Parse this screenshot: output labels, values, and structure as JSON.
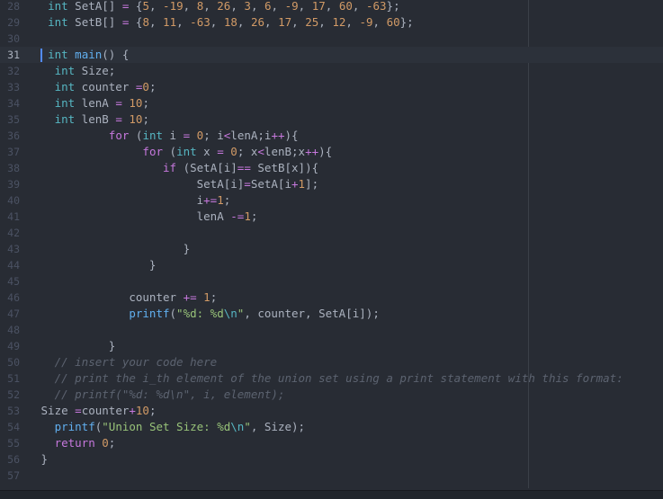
{
  "editor": {
    "active_line": 31,
    "wrap_guide_column": 80,
    "colors": {
      "background": "#282c34",
      "keyword": "#c678dd",
      "type": "#56b6c2",
      "function": "#61afef",
      "number": "#d19a66",
      "string": "#98c379",
      "comment": "#5c6370",
      "plain": "#abb2bf",
      "cursor": "#528bff"
    },
    "lines": [
      {
        "n": "28",
        "tokens": [
          [
            "pl",
            "  "
          ],
          [
            "ty",
            "int"
          ],
          [
            "pl",
            " SetA[] "
          ],
          [
            "op",
            "="
          ],
          [
            "pl",
            " {"
          ],
          [
            "num",
            "5"
          ],
          [
            "pl",
            ", "
          ],
          [
            "num",
            "-19"
          ],
          [
            "pl",
            ", "
          ],
          [
            "num",
            "8"
          ],
          [
            "pl",
            ", "
          ],
          [
            "num",
            "26"
          ],
          [
            "pl",
            ", "
          ],
          [
            "num",
            "3"
          ],
          [
            "pl",
            ", "
          ],
          [
            "num",
            "6"
          ],
          [
            "pl",
            ", "
          ],
          [
            "num",
            "-9"
          ],
          [
            "pl",
            ", "
          ],
          [
            "num",
            "17"
          ],
          [
            "pl",
            ", "
          ],
          [
            "num",
            "60"
          ],
          [
            "pl",
            ", "
          ],
          [
            "num",
            "-63"
          ],
          [
            "pl",
            "};"
          ]
        ]
      },
      {
        "n": "29",
        "tokens": [
          [
            "pl",
            "  "
          ],
          [
            "ty",
            "int"
          ],
          [
            "pl",
            " SetB[] "
          ],
          [
            "op",
            "="
          ],
          [
            "pl",
            " {"
          ],
          [
            "num",
            "8"
          ],
          [
            "pl",
            ", "
          ],
          [
            "num",
            "11"
          ],
          [
            "pl",
            ", "
          ],
          [
            "num",
            "-63"
          ],
          [
            "pl",
            ", "
          ],
          [
            "num",
            "18"
          ],
          [
            "pl",
            ", "
          ],
          [
            "num",
            "26"
          ],
          [
            "pl",
            ", "
          ],
          [
            "num",
            "17"
          ],
          [
            "pl",
            ", "
          ],
          [
            "num",
            "25"
          ],
          [
            "pl",
            ", "
          ],
          [
            "num",
            "12"
          ],
          [
            "pl",
            ", "
          ],
          [
            "num",
            "-9"
          ],
          [
            "pl",
            ", "
          ],
          [
            "num",
            "60"
          ],
          [
            "pl",
            "};"
          ]
        ]
      },
      {
        "n": "30",
        "tokens": []
      },
      {
        "n": "31",
        "tokens": [
          [
            "pl",
            "  "
          ],
          [
            "ty",
            "int"
          ],
          [
            "pl",
            " "
          ],
          [
            "fn",
            "main"
          ],
          [
            "pl",
            "() {"
          ]
        ]
      },
      {
        "n": "32",
        "tokens": [
          [
            "pl",
            "   "
          ],
          [
            "ty",
            "int"
          ],
          [
            "pl",
            " Size;"
          ]
        ]
      },
      {
        "n": "33",
        "tokens": [
          [
            "pl",
            "   "
          ],
          [
            "ty",
            "int"
          ],
          [
            "pl",
            " counter "
          ],
          [
            "op",
            "="
          ],
          [
            "num",
            "0"
          ],
          [
            "pl",
            ";"
          ]
        ]
      },
      {
        "n": "34",
        "tokens": [
          [
            "pl",
            "   "
          ],
          [
            "ty",
            "int"
          ],
          [
            "pl",
            " lenA "
          ],
          [
            "op",
            "="
          ],
          [
            "pl",
            " "
          ],
          [
            "num",
            "10"
          ],
          [
            "pl",
            ";"
          ]
        ]
      },
      {
        "n": "35",
        "tokens": [
          [
            "pl",
            "   "
          ],
          [
            "ty",
            "int"
          ],
          [
            "pl",
            " lenB "
          ],
          [
            "op",
            "="
          ],
          [
            "pl",
            " "
          ],
          [
            "num",
            "10"
          ],
          [
            "pl",
            ";"
          ]
        ]
      },
      {
        "n": "36",
        "tokens": [
          [
            "pl",
            "           "
          ],
          [
            "kw",
            "for"
          ],
          [
            "pl",
            " ("
          ],
          [
            "ty",
            "int"
          ],
          [
            "pl",
            " i "
          ],
          [
            "op",
            "="
          ],
          [
            "pl",
            " "
          ],
          [
            "num",
            "0"
          ],
          [
            "pl",
            "; i"
          ],
          [
            "op",
            "<"
          ],
          [
            "pl",
            "lenA;i"
          ],
          [
            "op",
            "++"
          ],
          [
            "pl",
            "){"
          ]
        ]
      },
      {
        "n": "37",
        "tokens": [
          [
            "pl",
            "                "
          ],
          [
            "kw",
            "for"
          ],
          [
            "pl",
            " ("
          ],
          [
            "ty",
            "int"
          ],
          [
            "pl",
            " x "
          ],
          [
            "op",
            "="
          ],
          [
            "pl",
            " "
          ],
          [
            "num",
            "0"
          ],
          [
            "pl",
            "; x"
          ],
          [
            "op",
            "<"
          ],
          [
            "pl",
            "lenB;x"
          ],
          [
            "op",
            "++"
          ],
          [
            "pl",
            "){"
          ]
        ]
      },
      {
        "n": "38",
        "tokens": [
          [
            "pl",
            "                   "
          ],
          [
            "kw",
            "if"
          ],
          [
            "pl",
            " (SetA[i]"
          ],
          [
            "op",
            "=="
          ],
          [
            "pl",
            " SetB[x]){"
          ]
        ]
      },
      {
        "n": "39",
        "tokens": [
          [
            "pl",
            "                        SetA[i]"
          ],
          [
            "op",
            "="
          ],
          [
            "pl",
            "SetA[i"
          ],
          [
            "op",
            "+"
          ],
          [
            "num",
            "1"
          ],
          [
            "pl",
            "];"
          ]
        ]
      },
      {
        "n": "40",
        "tokens": [
          [
            "pl",
            "                        i"
          ],
          [
            "op",
            "+="
          ],
          [
            "num",
            "1"
          ],
          [
            "pl",
            ";"
          ]
        ]
      },
      {
        "n": "41",
        "tokens": [
          [
            "pl",
            "                        lenA "
          ],
          [
            "op",
            "-="
          ],
          [
            "num",
            "1"
          ],
          [
            "pl",
            ";"
          ]
        ]
      },
      {
        "n": "42",
        "tokens": []
      },
      {
        "n": "43",
        "tokens": [
          [
            "pl",
            "                      }"
          ]
        ]
      },
      {
        "n": "44",
        "tokens": [
          [
            "pl",
            "                 }"
          ]
        ]
      },
      {
        "n": "45",
        "tokens": []
      },
      {
        "n": "46",
        "tokens": [
          [
            "pl",
            "              counter "
          ],
          [
            "op",
            "+="
          ],
          [
            "pl",
            " "
          ],
          [
            "num",
            "1"
          ],
          [
            "pl",
            ";"
          ]
        ]
      },
      {
        "n": "47",
        "tokens": [
          [
            "pl",
            "              "
          ],
          [
            "fn",
            "printf"
          ],
          [
            "pl",
            "("
          ],
          [
            "str",
            "\"%d: %d"
          ],
          [
            "esc",
            "\\n"
          ],
          [
            "str",
            "\""
          ],
          [
            "pl",
            ", counter, SetA[i]);"
          ]
        ]
      },
      {
        "n": "48",
        "tokens": []
      },
      {
        "n": "49",
        "tokens": [
          [
            "pl",
            "           }"
          ]
        ]
      },
      {
        "n": "50",
        "tokens": [
          [
            "pl",
            "   "
          ],
          [
            "cm",
            "// insert your code here"
          ]
        ]
      },
      {
        "n": "51",
        "tokens": [
          [
            "pl",
            "   "
          ],
          [
            "cm",
            "// print the i_th element of the union set using a print statement with this format:"
          ]
        ]
      },
      {
        "n": "52",
        "tokens": [
          [
            "pl",
            "   "
          ],
          [
            "cm",
            "// printf(\"%d: %d\\n\", i, element);"
          ]
        ]
      },
      {
        "n": "53",
        "tokens": [
          [
            "pl",
            " Size "
          ],
          [
            "op",
            "="
          ],
          [
            "pl",
            "counter"
          ],
          [
            "op",
            "+"
          ],
          [
            "num",
            "10"
          ],
          [
            "pl",
            ";"
          ]
        ]
      },
      {
        "n": "54",
        "tokens": [
          [
            "pl",
            "   "
          ],
          [
            "fn",
            "printf"
          ],
          [
            "pl",
            "("
          ],
          [
            "str",
            "\"Union Set Size: %d"
          ],
          [
            "esc",
            "\\n"
          ],
          [
            "str",
            "\""
          ],
          [
            "pl",
            ", Size);"
          ]
        ]
      },
      {
        "n": "55",
        "tokens": [
          [
            "pl",
            "   "
          ],
          [
            "kw",
            "return"
          ],
          [
            "pl",
            " "
          ],
          [
            "num",
            "0"
          ],
          [
            "pl",
            ";"
          ]
        ]
      },
      {
        "n": "56",
        "tokens": [
          [
            "pl",
            " }"
          ]
        ]
      },
      {
        "n": "57",
        "tokens": []
      }
    ]
  }
}
